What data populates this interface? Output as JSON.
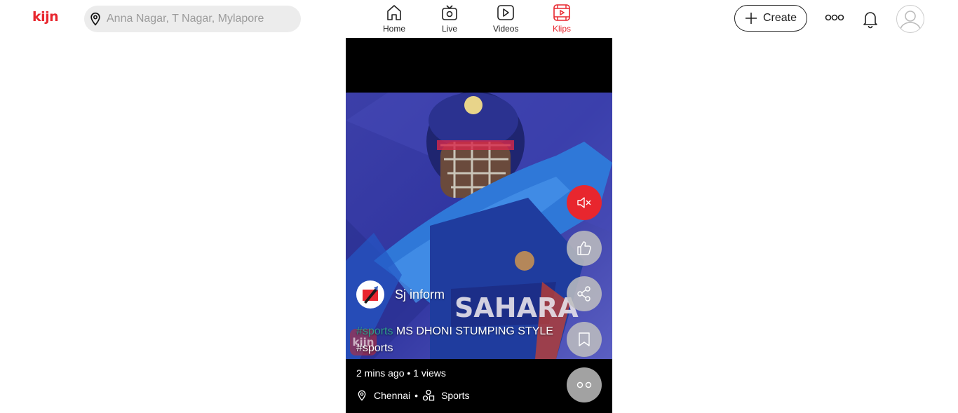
{
  "header": {
    "logo": "kijn",
    "location_placeholder": "Anna Nagar, T Nagar, Mylapore",
    "nav": [
      {
        "label": "Home",
        "icon": "home-icon",
        "active": false
      },
      {
        "label": "Live",
        "icon": "tv-icon",
        "active": false
      },
      {
        "label": "Videos",
        "icon": "play-icon",
        "active": false
      },
      {
        "label": "Klips",
        "icon": "klips-icon",
        "active": true
      }
    ],
    "create_label": "Create",
    "accent_color": "#e8262e"
  },
  "klip": {
    "channel_name": "Sj inform",
    "caption_hashtag": "#sports",
    "caption_text": "MS DHONI STUMPING STYLE",
    "caption_tag_line": "#sports",
    "watermark": "kijn",
    "posted": "2 mins ago",
    "views": "1 views",
    "location": "Chennai",
    "category": "Sports",
    "actions": [
      "mute-icon",
      "like-icon",
      "share-icon",
      "bookmark-icon",
      "more-icon"
    ]
  }
}
